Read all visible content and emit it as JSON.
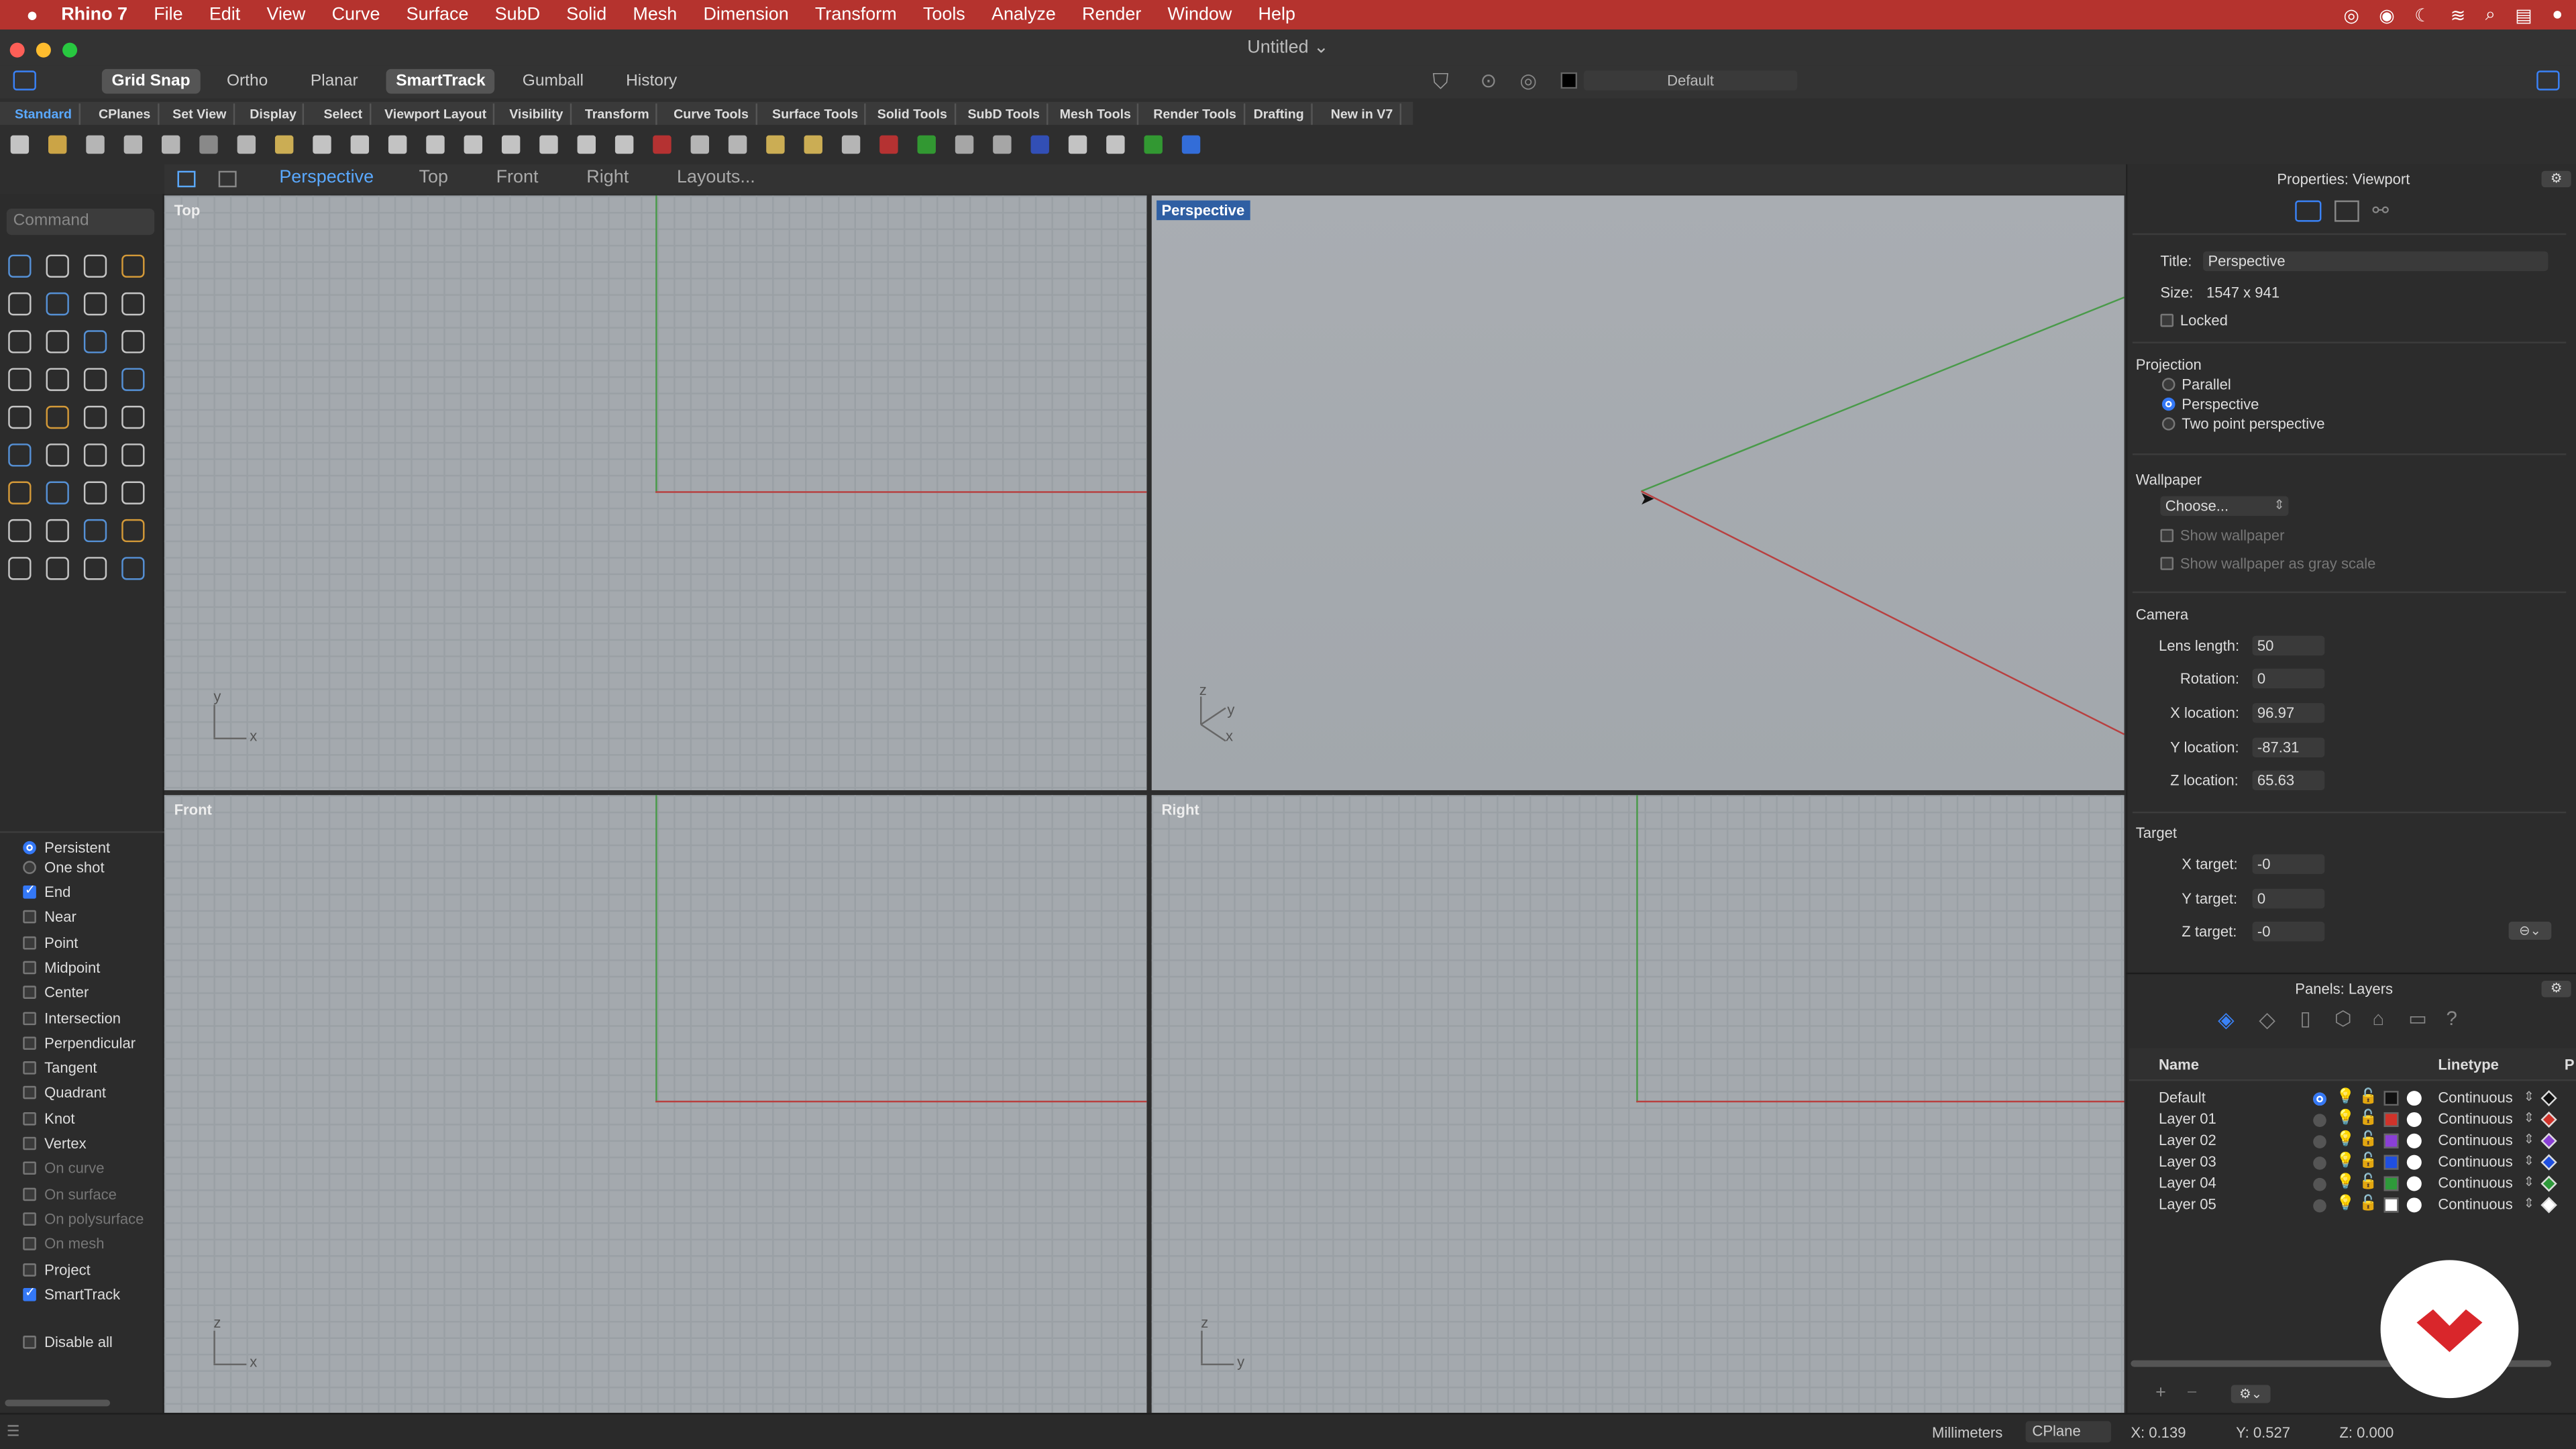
{
  "menubar": {
    "apple": "",
    "app": "Rhino 7",
    "items": [
      "File",
      "Edit",
      "View",
      "Curve",
      "Surface",
      "SubD",
      "Solid",
      "Mesh",
      "Dimension",
      "Transform",
      "Tools",
      "Analyze",
      "Render",
      "Window",
      "Help"
    ]
  },
  "window": {
    "title": "Untitled ⌄"
  },
  "modes": {
    "grid_snap": "Grid Snap",
    "ortho": "Ortho",
    "planar": "Planar",
    "smarttrack": "SmartTrack",
    "gumball": "Gumball",
    "history": "History",
    "layer": "Default"
  },
  "tabs": [
    "Standard",
    "CPlanes",
    "Set View",
    "Display",
    "Select",
    "Viewport Layout",
    "Visibility",
    "Transform",
    "Curve Tools",
    "Surface Tools",
    "Solid Tools",
    "SubD Tools",
    "Mesh Tools",
    "Render Tools",
    "Drafting",
    "New in V7"
  ],
  "viewport_tabs": [
    "Perspective",
    "Top",
    "Front",
    "Right",
    "Layouts..."
  ],
  "command": {
    "placeholder": "Command"
  },
  "osnaps": {
    "persistent": "Persistent",
    "one_shot": "One shot",
    "items": [
      {
        "label": "End",
        "checked": true
      },
      {
        "label": "Near",
        "checked": false
      },
      {
        "label": "Point",
        "checked": false
      },
      {
        "label": "Midpoint",
        "checked": false
      },
      {
        "label": "Center",
        "checked": false
      },
      {
        "label": "Intersection",
        "checked": false
      },
      {
        "label": "Perpendicular",
        "checked": false
      },
      {
        "label": "Tangent",
        "checked": false
      },
      {
        "label": "Quadrant",
        "checked": false
      },
      {
        "label": "Knot",
        "checked": false
      },
      {
        "label": "Vertex",
        "checked": false
      },
      {
        "label": "On curve",
        "checked": false
      },
      {
        "label": "On surface",
        "checked": false
      },
      {
        "label": "On polysurface",
        "checked": false
      },
      {
        "label": "On mesh",
        "checked": false
      },
      {
        "label": "Project",
        "checked": false
      },
      {
        "label": "SmartTrack",
        "checked": true
      }
    ],
    "disable_all": "Disable all"
  },
  "viewports": {
    "top": "Top",
    "perspective": "Perspective",
    "front": "Front",
    "right": "Right",
    "axes": {
      "top": [
        "y",
        "x"
      ],
      "persp": [
        "z",
        "y",
        "x"
      ],
      "front": [
        "z",
        "x"
      ],
      "right": [
        "z",
        "y"
      ]
    }
  },
  "properties": {
    "header": "Properties: Viewport",
    "title_label": "Title:",
    "title_value": "Perspective",
    "size_label": "Size:",
    "size_value": "1547 x 941",
    "locked": "Locked",
    "projection": "Projection",
    "parallel": "Parallel",
    "perspective": "Perspective",
    "two_point": "Two point perspective",
    "wallpaper": "Wallpaper",
    "choose": "Choose...",
    "show_wallpaper": "Show wallpaper",
    "show_gray": "Show wallpaper as gray scale",
    "camera": "Camera",
    "lens_label": "Lens length:",
    "lens": "50",
    "rotation_label": "Rotation:",
    "rotation": "0",
    "xloc_label": "X location:",
    "xloc": "96.97",
    "yloc_label": "Y location:",
    "yloc": "-87.31",
    "zloc_label": "Z location:",
    "zloc": "65.63",
    "target": "Target",
    "xt_label": "X target:",
    "xt": "-0",
    "yt_label": "Y target:",
    "yt": "0",
    "zt_label": "Z target:",
    "zt": "-0"
  },
  "layers": {
    "header": "Panels: Layers",
    "name_col": "Name",
    "linetype_col": "Linetype",
    "p_col": "P",
    "rows": [
      {
        "name": "Default",
        "color": "#111111",
        "linetype": "Continuous",
        "mat": "#111111"
      },
      {
        "name": "Layer 01",
        "color": "#d0332a",
        "linetype": "Continuous",
        "mat": "#d0332a"
      },
      {
        "name": "Layer 02",
        "color": "#8a3fd6",
        "linetype": "Continuous",
        "mat": "#8a3fd6"
      },
      {
        "name": "Layer 03",
        "color": "#1f4fe0",
        "linetype": "Continuous",
        "mat": "#1f4fe0"
      },
      {
        "name": "Layer 04",
        "color": "#2e9a3a",
        "linetype": "Continuous",
        "mat": "#2e9a3a"
      },
      {
        "name": "Layer 05",
        "color": "#ffffff",
        "linetype": "Continuous",
        "mat": "#ffffff"
      }
    ]
  },
  "status": {
    "units": "Millimeters",
    "cplane": "CPlane",
    "x": "X: 0.139",
    "y": "Y: 0.527",
    "z": "Z: 0.000"
  }
}
